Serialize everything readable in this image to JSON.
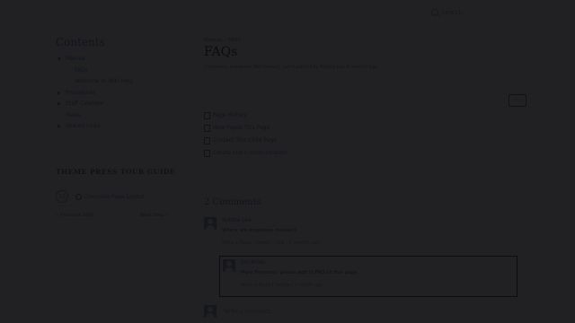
{
  "header": {
    "search_label": "Search"
  },
  "sidebar": {
    "contents_title": "Contents",
    "toc": [
      {
        "label": "Manual",
        "level": 0,
        "expanded": true
      },
      {
        "label": "FAQs",
        "level": 1
      },
      {
        "label": "Welcome to Wiki Help",
        "level": 1
      },
      {
        "label": "Procedures",
        "level": 0,
        "expanded": false
      },
      {
        "label": "Staff Calendar",
        "level": 0,
        "expanded": false
      },
      {
        "label": "News",
        "level": 0,
        "expanded": null
      },
      {
        "label": "Shared Links",
        "level": 0,
        "expanded": false
      }
    ],
    "guide_title": "THEME PRESS TOUR GUIDE",
    "guide_step": "10",
    "guide_item": "Overview Page Layout",
    "prev_label": "« Previous Step",
    "next_label": "Next Step »"
  },
  "main": {
    "breadcrumb": "Manual » FAQs",
    "title": "FAQs",
    "subtitle": "Commonly answered FAQ (wheel), last modified by Robbie Lee 4 months ago",
    "edit_icon": "pencil-icon",
    "page_links": [
      "Page History",
      "New Pages This Page",
      "Contact This Child Page",
      "Create Sub Communication"
    ],
    "comments_title": "2 Comments",
    "comments": [
      {
        "author": "Robbie Lee",
        "text": "Where are employee reviews?",
        "meta": "Write a Reply | Delete | Link | 2 months ago"
      },
      {
        "author": "Jon Arlab",
        "text": "Mary Forrestor, please add to FAQ on this page",
        "meta": "Write a Reply | Delete | 1 month ago"
      }
    ],
    "write_comment": "Write a comment..."
  }
}
